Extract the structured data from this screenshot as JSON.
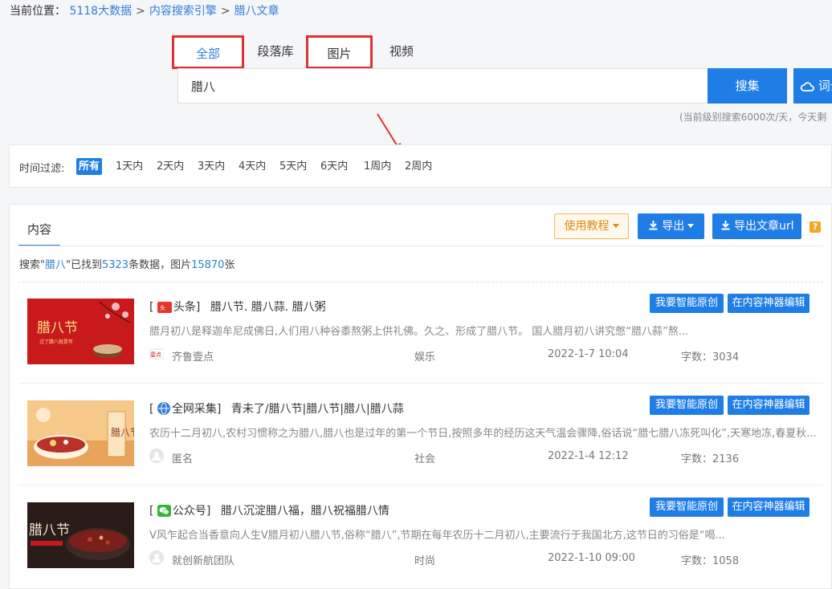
{
  "breadcrumb": {
    "prefix": "当前位置：",
    "items": [
      "5118大数据",
      "内容搜索引擎",
      "腊八文章"
    ],
    "separator": ">"
  },
  "tabs": [
    {
      "label": "全部",
      "active": true,
      "highlighted": true
    },
    {
      "label": "段落库",
      "active": false,
      "highlighted": false
    },
    {
      "label": "图片",
      "active": false,
      "highlighted": true
    },
    {
      "label": "视频",
      "active": false,
      "highlighted": false
    }
  ],
  "search": {
    "value": "腊八",
    "button_label": "搜集",
    "cloud_label": "词云"
  },
  "quota_text": "(当前级别搜索6000次/天，今天剩",
  "filter": {
    "label": "时间过滤:",
    "options": [
      "所有",
      "1天内",
      "2天内",
      "3天内",
      "4天内",
      "5天内",
      "6天内",
      "1周内",
      "2周内"
    ],
    "selected": "所有"
  },
  "panel": {
    "tab_label": "内容",
    "guide_label": "使用教程",
    "export_label": "导出",
    "export_url_label": "导出文章url",
    "help_icon": "?"
  },
  "summary": {
    "p1": "搜索\"",
    "keyword": "腊八",
    "p2": "\"已找到",
    "count": "5323",
    "p3": "条数据，图片",
    "images": "15870",
    "p4": "张"
  },
  "results": [
    {
      "source_bracket_open": "[",
      "source": "头条]",
      "source_icon": "toutiao-icon",
      "title": "腊八节. 腊八蒜. 腊八粥",
      "desc": "腊月初八是释迦牟尼成佛日,人们用八种谷黍熬粥上供礼佛。久之、形成了腊八节。 国人腊月初八讲究憋“腊八蒜”熬...",
      "author": "齐鲁壹点",
      "category": "娱乐",
      "date": "2022-1-7 10:04",
      "words": "字数：3034",
      "ai_label": "我要智能原创",
      "edit_label": "在内容神器编辑"
    },
    {
      "source_bracket_open": "[",
      "source": "全网采集]",
      "source_icon": "globe-icon",
      "title": "青未了/腊八节|腊八节|腊八|腊八蒜",
      "desc": "农历十二月初八,农村习惯称之为腊八,腊八也是过年的第一个节日,按照多年的经历这天气温会骤降,俗话说“腊七腊八冻死叫化”,天寒地冻,春夏秋...",
      "author": "匿名",
      "category": "社会",
      "date": "2022-1-4 12:12",
      "words": "字数：2136",
      "ai_label": "我要智能原创",
      "edit_label": "在内容神器编辑"
    },
    {
      "source_bracket_open": "[",
      "source": "公众号]",
      "source_icon": "wechat-icon",
      "title": "腊八沉淀腊八福，腊八祝福腊八情",
      "desc": "V风乍起合当香意向人生V腊月初八腊八节,俗称“腊八”,节期在每年农历十二月初八,主要流行于我国北方,这节日的习俗是“喝...",
      "author": "就创新航团队",
      "category": "时尚",
      "date": "2022-1-10 09:00",
      "words": "字数：1058",
      "ai_label": "我要智能原创",
      "edit_label": "在内容神器编辑"
    }
  ],
  "thumb_text": {
    "t1": "腊八节",
    "t1_sub": "过了腊八就是年",
    "t2": "腊八节",
    "t3": "腊八节"
  },
  "author_logo_text": "壹点",
  "colors": {
    "accent": "#1f7de6",
    "highlight_border": "#e03030",
    "link": "#2f7fd6",
    "guide": "#e08a10"
  }
}
